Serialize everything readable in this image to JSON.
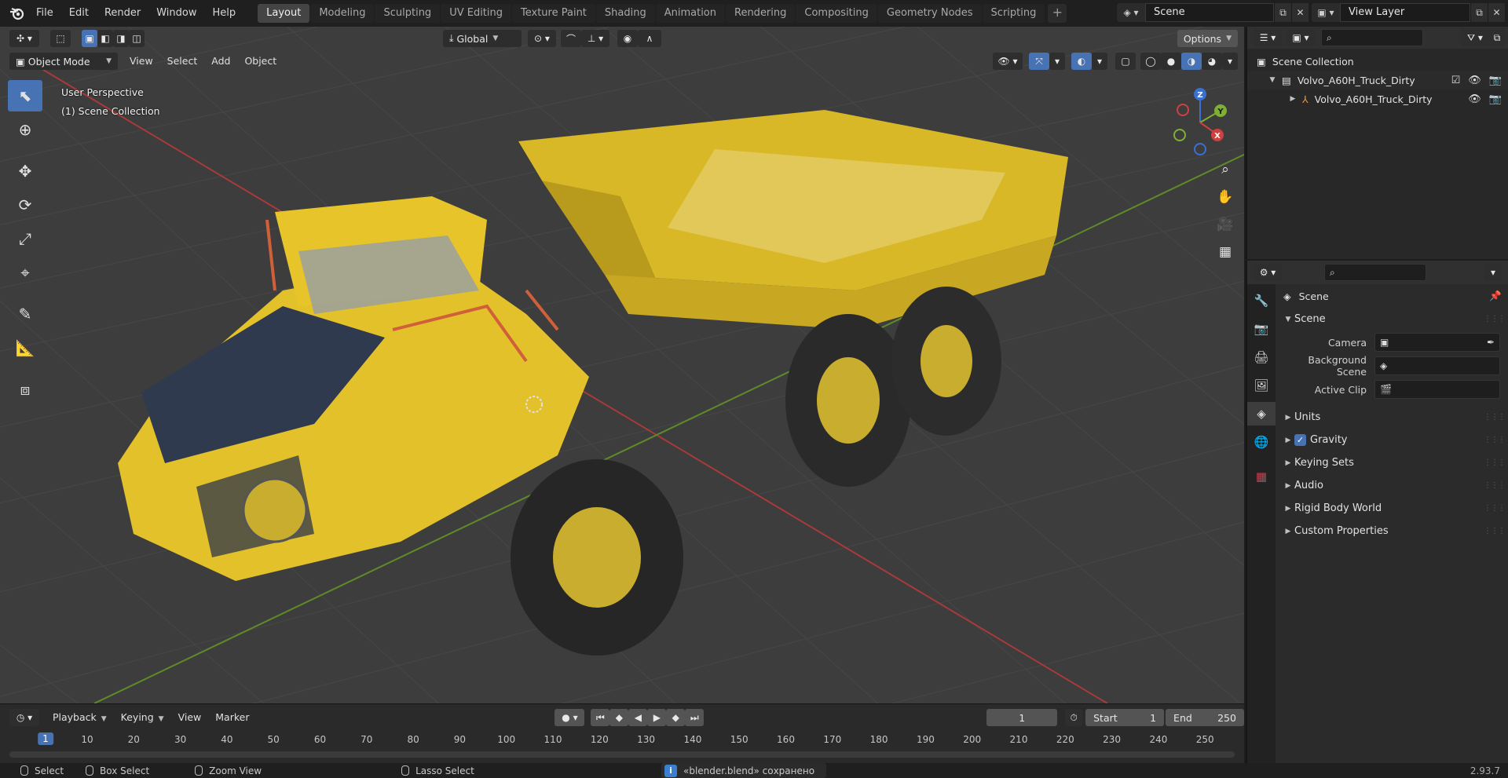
{
  "topbar": {
    "menus": [
      "File",
      "Edit",
      "Render",
      "Window",
      "Help"
    ],
    "workspaces": [
      "Layout",
      "Modeling",
      "Sculpting",
      "UV Editing",
      "Texture Paint",
      "Shading",
      "Animation",
      "Rendering",
      "Compositing",
      "Geometry Nodes",
      "Scripting"
    ],
    "active_workspace": "Layout",
    "add_workspace": "+",
    "scene": "Scene",
    "view_layer": "View Layer"
  },
  "viewport": {
    "header": {
      "transform_orientation": "Global",
      "options": "Options",
      "mode": "Object Mode",
      "menus": [
        "View",
        "Select",
        "Add",
        "Object"
      ]
    },
    "info": {
      "perspective": "User Perspective",
      "collection": "(1) Scene Collection"
    },
    "gizmo": {
      "x": "X",
      "y": "Y",
      "z": "Z"
    },
    "colors": {
      "x_axis": "#d04040",
      "y_axis": "#80b030",
      "z_axis": "#3a70d0",
      "accent": "#4772b3",
      "truck_yellow": "#e6c42a"
    }
  },
  "timeline": {
    "menus": [
      "Playback",
      "Keying",
      "View",
      "Marker"
    ],
    "current_frame": "1",
    "start_label": "Start",
    "start_value": "1",
    "end_label": "End",
    "end_value": "250",
    "ruler": [
      "1",
      "10",
      "20",
      "30",
      "40",
      "50",
      "60",
      "70",
      "80",
      "90",
      "100",
      "110",
      "120",
      "130",
      "140",
      "150",
      "160",
      "170",
      "180",
      "190",
      "200",
      "210",
      "220",
      "230",
      "240",
      "250"
    ]
  },
  "statusbar": {
    "select": "Select",
    "box_select": "Box Select",
    "zoom_view": "Zoom View",
    "lasso_select": "Lasso Select",
    "message": "«blender.blend» сохранено",
    "version": "2.93.7"
  },
  "outliner": {
    "root": "Scene Collection",
    "collection": "Volvo_A60H_Truck_Dirty",
    "object": "Volvo_A60H_Truck_Dirty"
  },
  "properties": {
    "context": "Scene",
    "section": "Scene",
    "camera_label": "Camera",
    "background_scene_label": "Background Scene",
    "active_clip_label": "Active Clip",
    "panels": [
      "Units",
      "Gravity",
      "Keying Sets",
      "Audio",
      "Rigid Body World",
      "Custom Properties"
    ]
  }
}
